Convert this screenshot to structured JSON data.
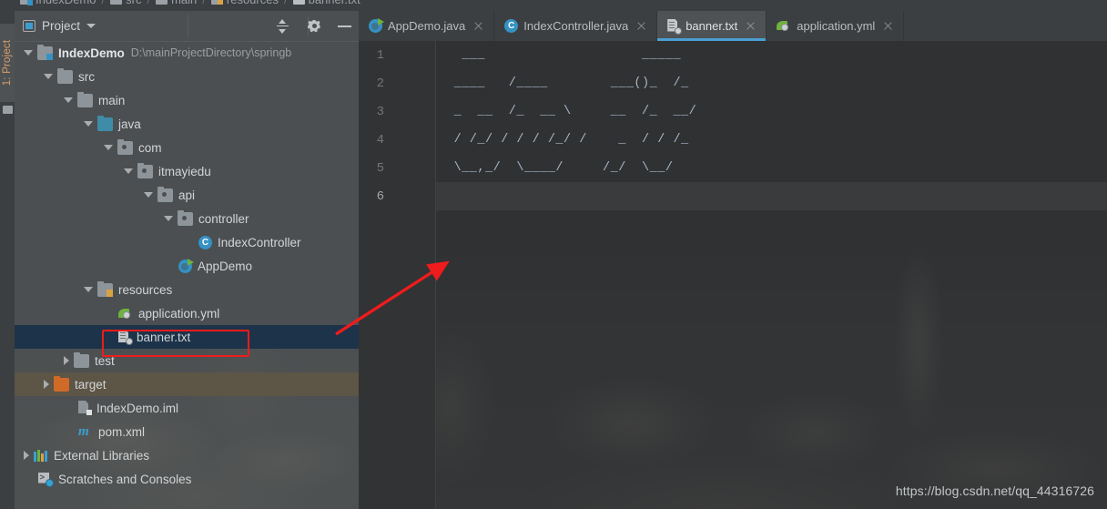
{
  "breadcrumb": {
    "items": [
      {
        "label": "IndexDemo",
        "icon": "module-icon"
      },
      {
        "label": "src",
        "icon": "folder-icon"
      },
      {
        "label": "main",
        "icon": "folder-icon"
      },
      {
        "label": "resources",
        "icon": "resources-folder-icon"
      },
      {
        "label": "banner.txt",
        "icon": "text-file-icon"
      }
    ],
    "separator": "/"
  },
  "tool_window_tab": {
    "label": "1: Project",
    "icon": "project-icon"
  },
  "project_panel": {
    "title": "Project",
    "title_icon": "project-view-icon",
    "dropdown_icon": "chevron-down-icon",
    "tools": [
      {
        "name": "collapse-all-icon",
        "label": "Collapse All"
      },
      {
        "name": "gear-icon",
        "label": "Settings"
      },
      {
        "name": "minimize-icon",
        "label": "Hide"
      }
    ],
    "tree": [
      {
        "label": "IndexDemo",
        "sub": "D:\\mainProjectDirectory\\springb",
        "indent": 0,
        "arrow": "down",
        "icon": "module-folder-icon",
        "bold": true,
        "state": "normal"
      },
      {
        "label": "src",
        "sub": "",
        "indent": 1,
        "arrow": "down",
        "icon": "folder-icon",
        "bold": false,
        "state": "normal"
      },
      {
        "label": "main",
        "sub": "",
        "indent": 2,
        "arrow": "down",
        "icon": "folder-icon",
        "bold": false,
        "state": "normal"
      },
      {
        "label": "java",
        "sub": "",
        "indent": 3,
        "arrow": "down",
        "icon": "source-folder-icon",
        "bold": false,
        "state": "normal"
      },
      {
        "label": "com",
        "sub": "",
        "indent": 4,
        "arrow": "down",
        "icon": "package-icon",
        "bold": false,
        "state": "normal"
      },
      {
        "label": "itmayiedu",
        "sub": "",
        "indent": 5,
        "arrow": "down",
        "icon": "package-icon",
        "bold": false,
        "state": "normal"
      },
      {
        "label": "api",
        "sub": "",
        "indent": 6,
        "arrow": "down",
        "icon": "package-icon",
        "bold": false,
        "state": "normal"
      },
      {
        "label": "controller",
        "sub": "",
        "indent": 7,
        "arrow": "down",
        "icon": "package-icon",
        "bold": false,
        "state": "normal"
      },
      {
        "label": "IndexController",
        "sub": "",
        "indent": 8,
        "arrow": "none",
        "icon": "java-class-icon",
        "bold": false,
        "state": "normal"
      },
      {
        "label": "AppDemo",
        "sub": "",
        "indent": 7,
        "arrow": "none",
        "icon": "spring-boot-class-icon",
        "bold": false,
        "state": "normal"
      },
      {
        "label": "resources",
        "sub": "",
        "indent": 3,
        "arrow": "down",
        "icon": "resources-folder-icon",
        "bold": false,
        "state": "normal"
      },
      {
        "label": "application.yml",
        "sub": "",
        "indent": 4,
        "arrow": "none",
        "icon": "spring-yaml-icon",
        "bold": false,
        "state": "normal"
      },
      {
        "label": "banner.txt",
        "sub": "",
        "indent": 4,
        "arrow": "none",
        "icon": "text-file-icon",
        "bold": false,
        "state": "selected"
      },
      {
        "label": "test",
        "sub": "",
        "indent": 2,
        "arrow": "right",
        "icon": "folder-icon",
        "bold": false,
        "state": "normal"
      },
      {
        "label": "target",
        "sub": "",
        "indent": 1,
        "arrow": "right",
        "icon": "excluded-folder-icon",
        "bold": false,
        "state": "highlighted"
      },
      {
        "label": "IndexDemo.iml",
        "sub": "",
        "indent": 2,
        "arrow": "none",
        "icon": "iml-file-icon",
        "bold": false,
        "state": "normal"
      },
      {
        "label": "pom.xml",
        "sub": "",
        "indent": 2,
        "arrow": "none",
        "icon": "maven-icon",
        "bold": false,
        "state": "normal"
      },
      {
        "label": "External Libraries",
        "sub": "",
        "indent": 0,
        "arrow": "right",
        "icon": "libraries-icon",
        "bold": false,
        "state": "normal"
      },
      {
        "label": "Scratches and Consoles",
        "sub": "",
        "indent": 0,
        "arrow": "none",
        "icon": "scratches-icon",
        "bold": false,
        "state": "normal"
      }
    ]
  },
  "editor": {
    "tabs": [
      {
        "label": "AppDemo.java",
        "icon": "spring-boot-class-icon",
        "active": false
      },
      {
        "label": "IndexController.java",
        "icon": "java-class-icon",
        "active": false
      },
      {
        "label": "banner.txt",
        "icon": "text-file-icon",
        "active": true
      },
      {
        "label": "application.yml",
        "icon": "spring-yaml-icon",
        "active": false
      }
    ],
    "close_icon": "close-icon",
    "line_numbers": [
      "1",
      "2",
      "3",
      "4",
      "5",
      "6"
    ],
    "current_line": "6",
    "content_lines": [
      "  ___                    _____  ",
      " ____   /____        ___()_  /_ ",
      " _  __  /_  __ \\     __  /_  __/",
      " / /_/ / / / /_/ /    _  / / /_  ",
      " \\__,_/  \\____/     /_/  \\__/  "
    ]
  },
  "annotations": {
    "highlight_box_target": "banner.txt",
    "arrow_description": "red-arrow-pointing-to-editor",
    "arrow_color": "#ee1c1c",
    "box_color": "#ee1c1c"
  },
  "watermark": {
    "text": "https://blog.csdn.net/qq_44316726"
  }
}
